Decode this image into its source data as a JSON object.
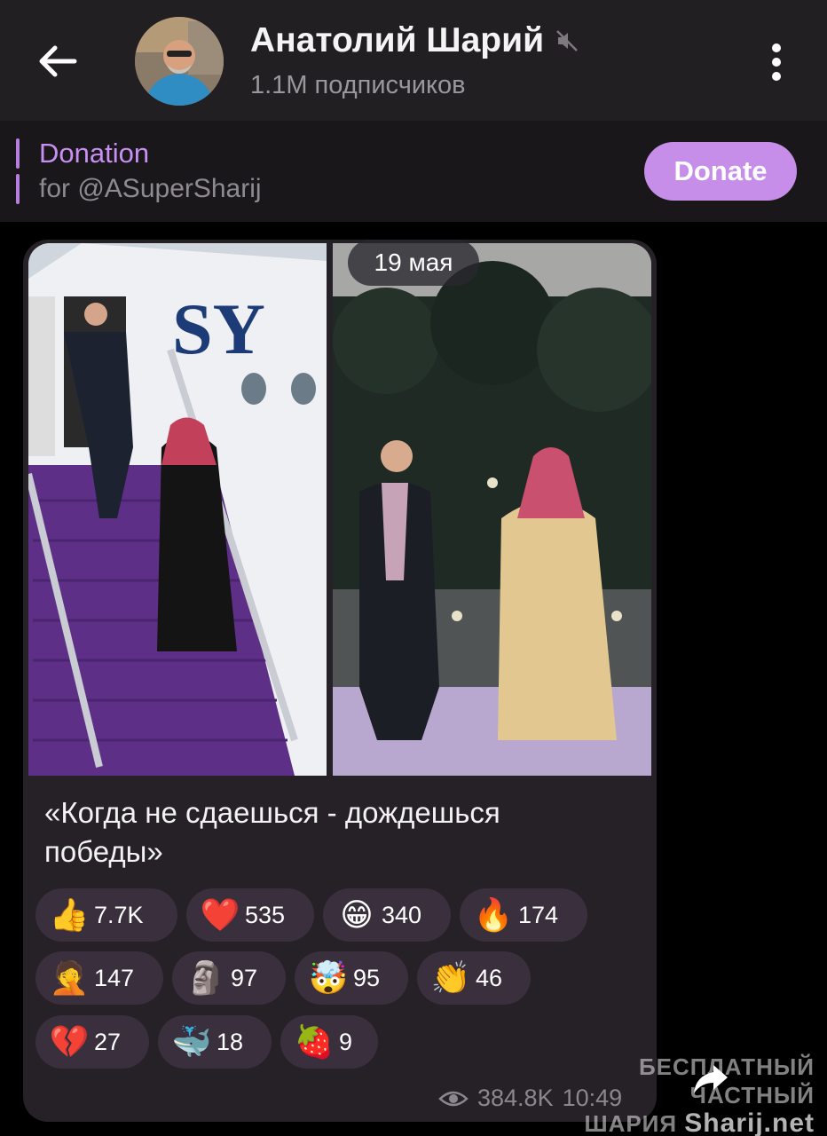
{
  "header": {
    "channel_name": "Анатолий Шарий",
    "subscribers": "1.1M подписчиков"
  },
  "pinned": {
    "title": "Donation",
    "subtitle": "for @ASuperSharij",
    "button_label": "Donate"
  },
  "message": {
    "date_chip": "19 мая",
    "text": "«Когда не сдаешься - дождешься победы»",
    "photo_sign_text": "SY",
    "views": "384.8K",
    "time": "10:49"
  },
  "reactions": [
    {
      "icon": "thumbs-up-icon",
      "glyph": "👍",
      "count": "7.7K"
    },
    {
      "icon": "heart-icon",
      "glyph": "❤️",
      "count": "535"
    },
    {
      "icon": "grinning-face-icon",
      "glyph": "😁",
      "count": "340"
    },
    {
      "icon": "fire-icon",
      "glyph": "🔥",
      "count": "174"
    },
    {
      "icon": "facepalm-icon",
      "glyph": "🤦",
      "count": "147"
    },
    {
      "icon": "moai-icon",
      "glyph": "🗿",
      "count": "97"
    },
    {
      "icon": "exploding-head-icon",
      "glyph": "🤯",
      "count": "95"
    },
    {
      "icon": "clapping-hands-icon",
      "glyph": "👏",
      "count": "46"
    },
    {
      "icon": "broken-heart-icon",
      "glyph": "💔",
      "count": "27"
    },
    {
      "icon": "whale-icon",
      "glyph": "🐳",
      "count": "18"
    },
    {
      "icon": "strawberry-icon",
      "glyph": "🍓",
      "count": "9"
    }
  ],
  "watermark": {
    "line1": "БЕСПЛАТНЫЙ ЧАСТНЫЙ",
    "line2": "ШАРИЯ",
    "site": "Sharij.net"
  },
  "colors": {
    "header_bg": "#221f23",
    "accent": "#c68ee9",
    "bubble_bg": "#252126",
    "reaction_bg": "#3a2f3d"
  }
}
